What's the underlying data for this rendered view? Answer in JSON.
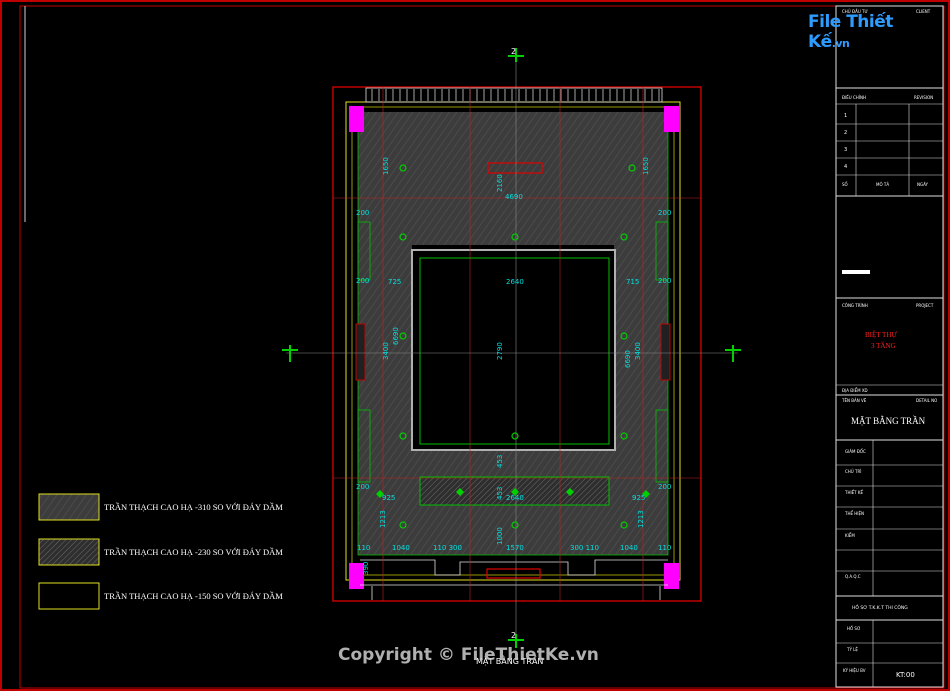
{
  "drawing": {
    "section_marker_top": "2",
    "section_marker_bottom": "2",
    "sheet_title_under_plan": "MẶT BẰNG TRẦN"
  },
  "legend": [
    {
      "label": "TRẦN THẠCH CAO HẠ -310 SO VỚI ĐÁY DẦM",
      "fill": "#3a3a3a"
    },
    {
      "label": "TRẦN THẠCH CAO HẠ -230 SO VỚI ĐÁY DẦM",
      "fill": "#4a4a4a"
    },
    {
      "label": "TRẦN THẠCH CAO HẠ -150 SO VỚI ĐÁY DẦM",
      "fill": "#000000"
    }
  ],
  "dimensions": {
    "top_width": "4690",
    "inner_width": "2640",
    "bottom_width": "2640",
    "inner_height": "2790",
    "top_rise": "2160",
    "left_top": "1650",
    "right_top": "1650",
    "left_200a": "200",
    "right_200a": "200",
    "left_200b": "200",
    "right_200b": "200",
    "left_200c": "200",
    "right_200c": "200",
    "left_725": "725",
    "right_715": "715",
    "left_3400": "3400",
    "left_6690": "6690",
    "right_3400": "3400",
    "right_6690": "6690",
    "left_925": "925",
    "right_925": "925",
    "left_1213": "1213",
    "right_1213": "1213",
    "mid_453": "453",
    "mid_453b": "453",
    "bottom_110a": "110",
    "bottom_1040a": "1040",
    "bottom_110_300": "110 300",
    "bottom_1570": "1570",
    "bottom_300_110": "300 110",
    "bottom_1040b": "1040",
    "bottom_110b": "110",
    "bottom_1000": "1000",
    "bottom_390": "390"
  },
  "title_block": {
    "client_label": "CHỦ ĐẦU TƯ",
    "client_label_en": "CLIENT",
    "revision_label": "ĐIỀU CHỈNH",
    "revision_label_en": "REVISION",
    "rev_rows": [
      "1",
      "2",
      "3",
      "4"
    ],
    "rev_no": "SỐ",
    "rev_desc": "MÔ TẢ",
    "rev_date": "NGÀY",
    "project_label": "CÔNG TRÌNH",
    "project_label_en": "PROJECT",
    "project_name_1": "BIỆT THỰ",
    "project_name_2": "3 TẦNG",
    "address_label": "ĐỊA ĐIỂM XD",
    "drawing_name_label": "TÊN BẢN VẼ",
    "drawing_name_label_en": "DETAIL NO",
    "drawing_name": "MẶT BẰNG TRẦN",
    "roles": [
      "GIÁM ĐỐC",
      "CHỦ TRÌ",
      "THIẾT KẾ",
      "THỂ HIỆN",
      "KIỂM",
      "Q.A.Q.C"
    ],
    "phase": "HỒ SƠ T.K.K.T THI CÔNG",
    "sheet_no_label": "HỒ SƠ",
    "scale_label": "TỶ LỆ",
    "sheet_code_label": "KÝ HIỆU BV",
    "sheet_code": "KT:00"
  },
  "watermark": {
    "logo_main": "File Thiết Kế",
    "logo_suffix": ".vn",
    "copyright": "Copyright © FileThietKe.vn"
  },
  "colors": {
    "frame": "#c00000",
    "wall": "#e0e020",
    "green": "#00d000",
    "cyan": "#00e0e0",
    "column": "#ff00ff",
    "axis": "#c02020"
  }
}
